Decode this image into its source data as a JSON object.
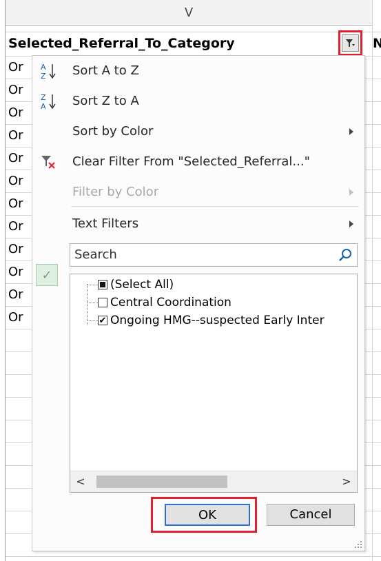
{
  "column": {
    "letter": "V",
    "next_letter": "N"
  },
  "header_cell": {
    "text": "Selected_Referral_To_Category"
  },
  "rows": [
    "Or",
    "Or",
    "Or",
    "Or",
    "Or",
    "Or",
    "Or",
    "Or",
    "Or",
    "Or",
    "Or",
    "Or"
  ],
  "menu": {
    "items": [
      {
        "label": "Sort A to Z",
        "icon": "sort-a-z-icon",
        "disabled": false,
        "submenu": false
      },
      {
        "label": "Sort Z to A",
        "icon": "sort-z-a-icon",
        "disabled": false,
        "submenu": false
      },
      {
        "label": "Sort by Color",
        "icon": "",
        "disabled": false,
        "submenu": true
      },
      {
        "label": "Clear Filter From \"Selected_Referral...\"",
        "icon": "clear-filter-icon",
        "disabled": false,
        "submenu": false
      },
      {
        "label": "Filter by Color",
        "icon": "",
        "disabled": true,
        "submenu": true
      },
      {
        "label": "Text Filters",
        "icon": "",
        "disabled": false,
        "submenu": true
      }
    ]
  },
  "search": {
    "placeholder": "Search"
  },
  "filter_list": {
    "items": [
      {
        "label": "(Select All)",
        "state": "partial"
      },
      {
        "label": "Central Coordination",
        "state": "unchecked"
      },
      {
        "label": "Ongoing HMG--suspected Early Inter",
        "state": "checked"
      }
    ]
  },
  "buttons": {
    "ok": "OK",
    "cancel": "Cancel"
  },
  "colors": {
    "highlight": "#e0202c",
    "ok_focus": "#2b6fd6"
  }
}
